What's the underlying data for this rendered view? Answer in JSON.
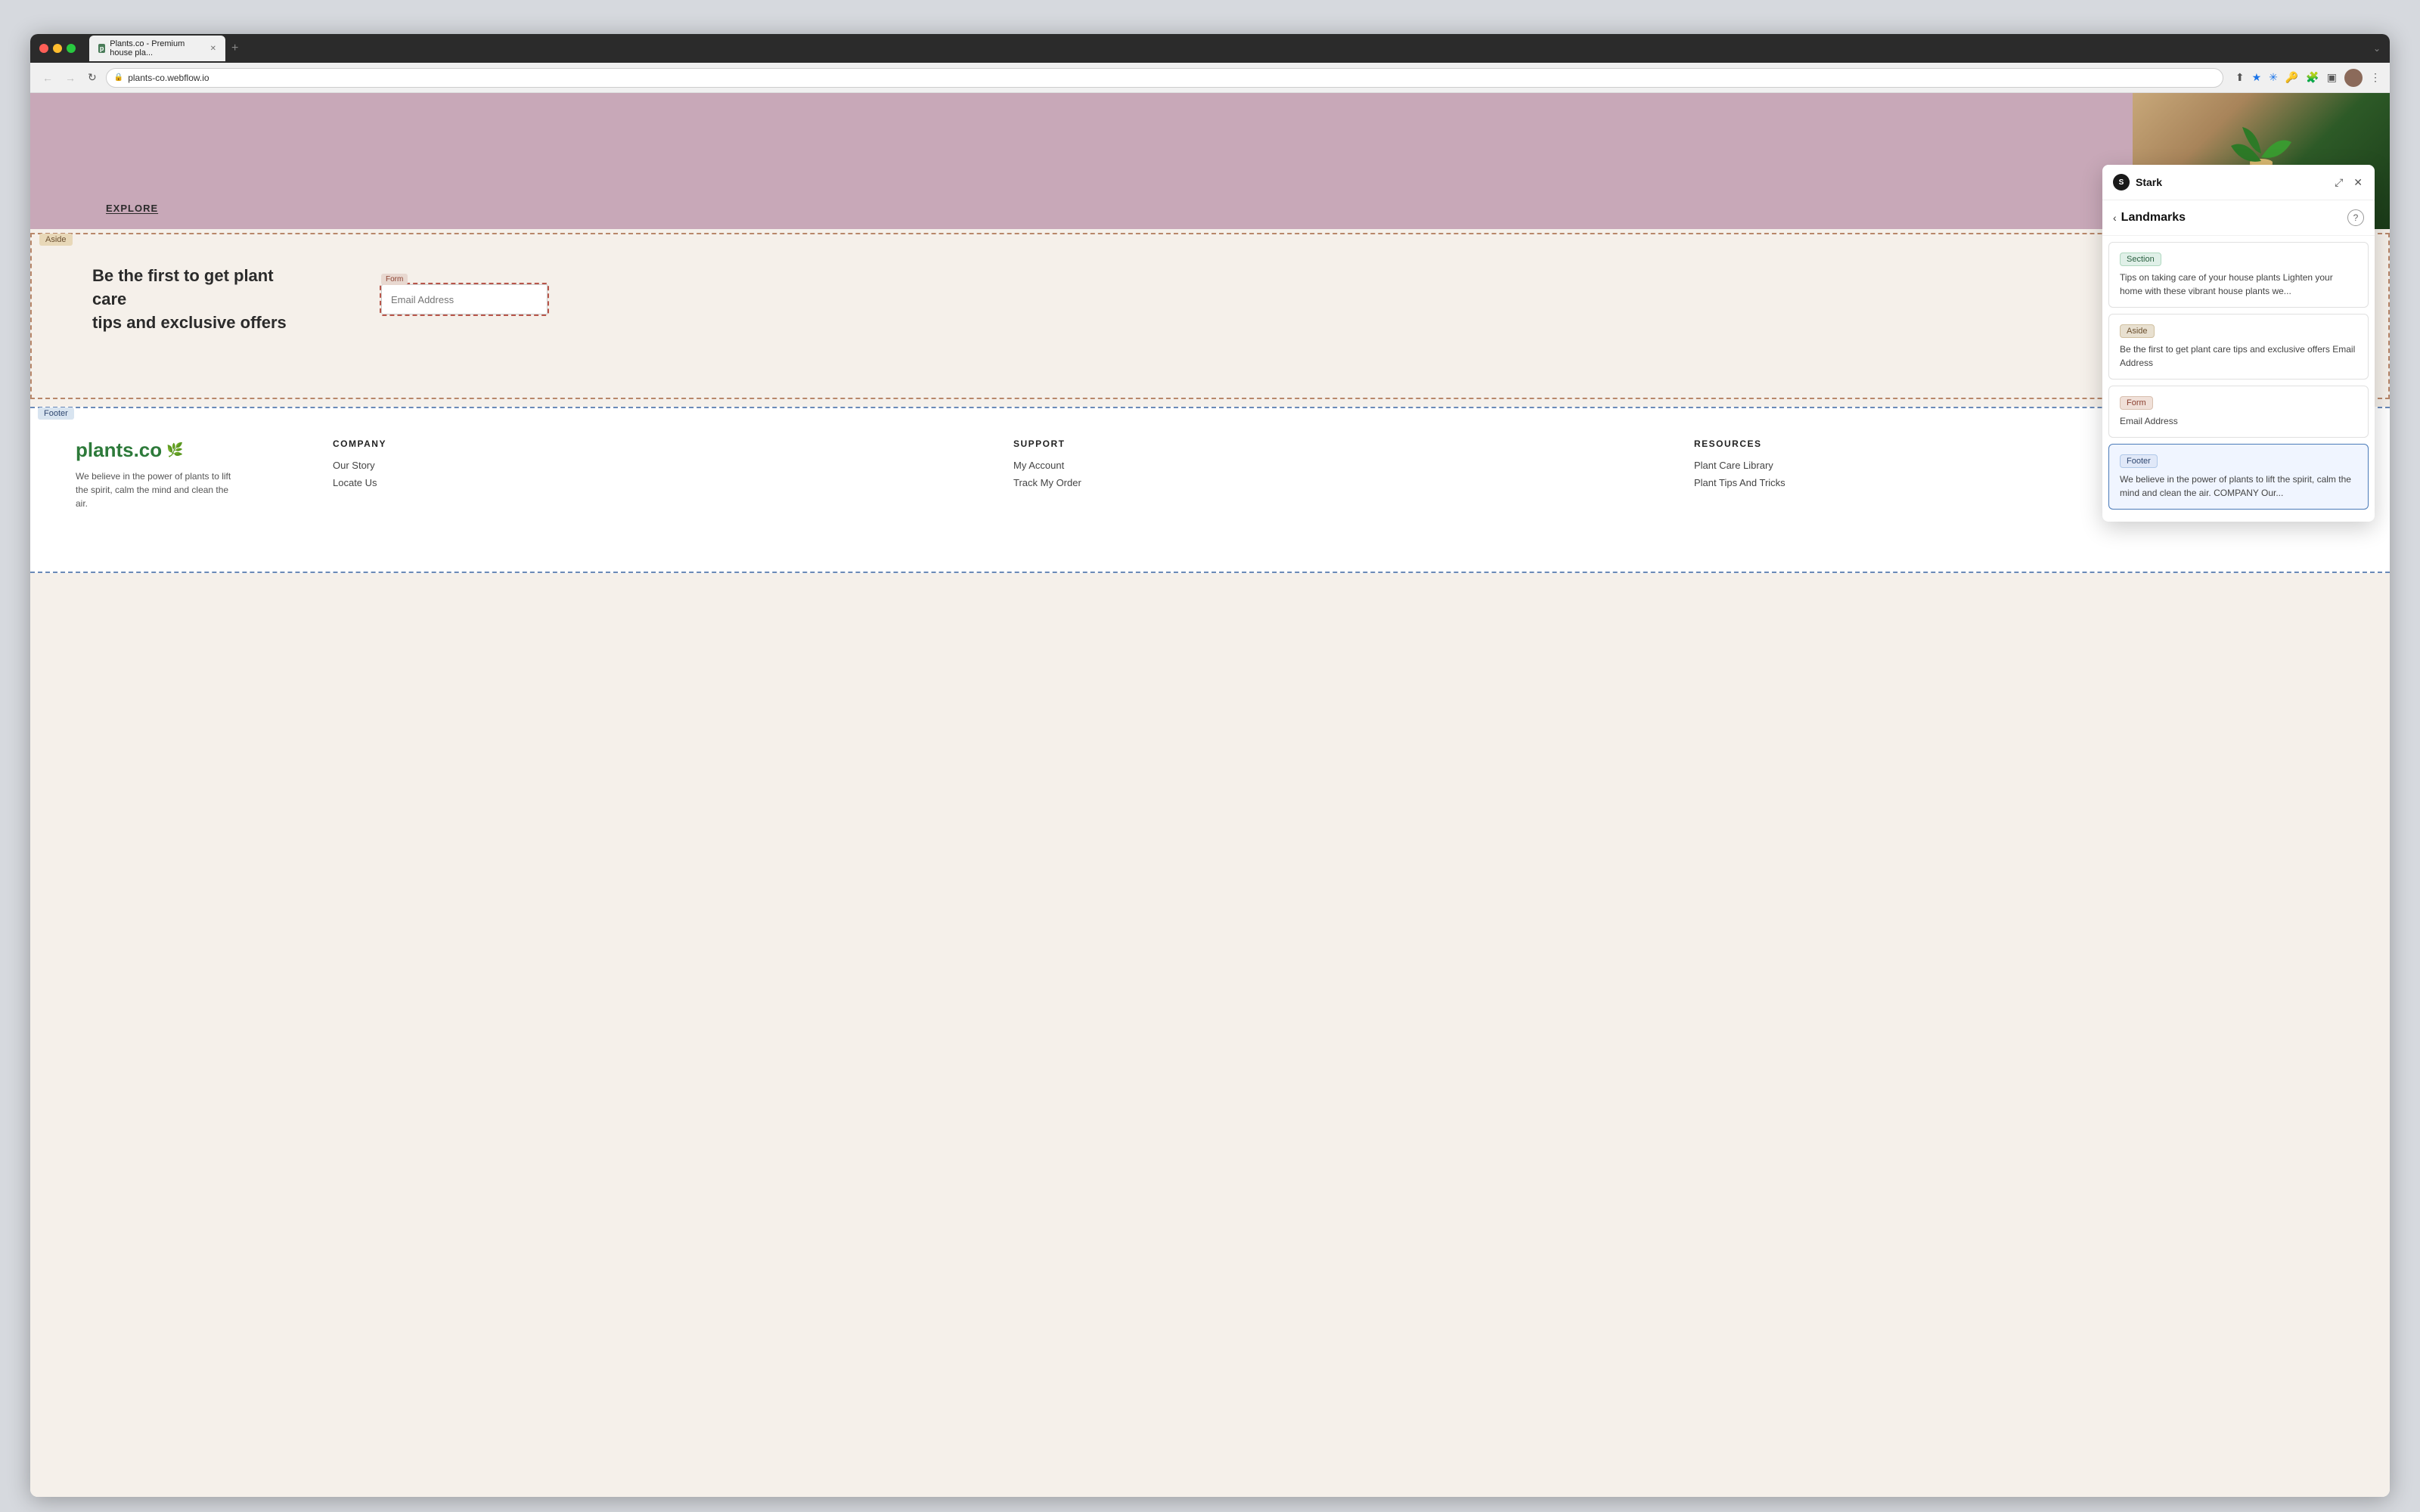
{
  "browser": {
    "url": "plants-co.webflow.io",
    "tab_title": "Plants.co - Premium house pla...",
    "tab_add_label": "+",
    "nav": {
      "back": "←",
      "forward": "→",
      "refresh": "↻"
    }
  },
  "page": {
    "explore_link": "EXPLORE",
    "aside": {
      "label": "Aside",
      "heading_line1": "Be the first to get plant care",
      "heading_line2": "tips and exclusive offers",
      "form": {
        "label": "Form",
        "email_placeholder": "Email Address"
      }
    },
    "footer": {
      "label": "Footer",
      "brand_name": "plants.co",
      "brand_tagline": "We believe in the power of plants to lift the spirit, calm the mind and clean the air.",
      "columns": [
        {
          "title": "COMPANY",
          "links": [
            "Our Story",
            "Locate Us"
          ]
        },
        {
          "title": "SUPPORT",
          "links": [
            "My Account",
            "Track My Order"
          ]
        },
        {
          "title": "RESOURCES",
          "links": [
            "Plant Care Library",
            "Plant Tips And Tricks"
          ]
        }
      ]
    }
  },
  "stark": {
    "app_name": "Stark",
    "panel_title": "Landmarks",
    "help_label": "?",
    "back_label": "‹",
    "expand_label": "⤢",
    "close_label": "✕",
    "items": [
      {
        "badge": "Section",
        "badge_type": "section",
        "description": "Tips on taking care of your house plants Lighten your home with these vibrant house plants we..."
      },
      {
        "badge": "Aside",
        "badge_type": "aside",
        "description": "Be the first to get plant care tips and exclusive offers Email Address"
      },
      {
        "badge": "Form",
        "badge_type": "form",
        "description": "Email Address"
      },
      {
        "badge": "Footer",
        "badge_type": "footer",
        "description": "We believe in the power of plants to lift the spirit, calm the mind and clean the air. COMPANY Our...",
        "selected": true
      }
    ]
  }
}
